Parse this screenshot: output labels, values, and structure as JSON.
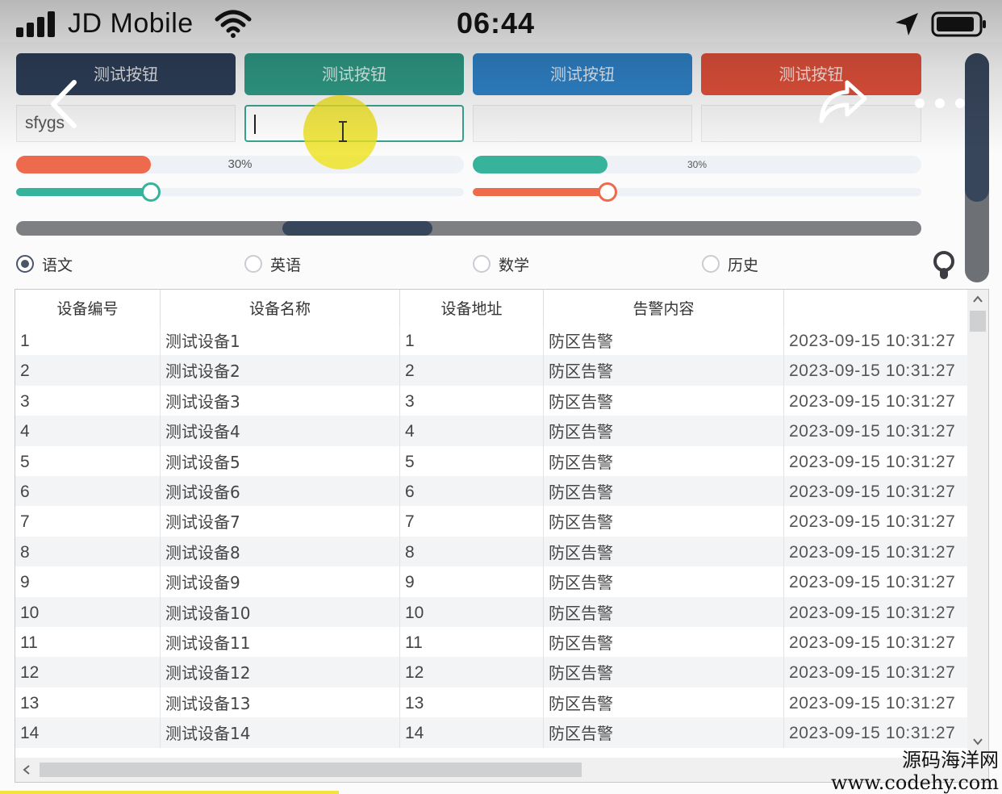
{
  "status_bar": {
    "carrier": "JD Mobile",
    "time": "06:44",
    "icons": [
      "signal-icon",
      "wifi-icon",
      "location-arrow-icon",
      "battery-icon"
    ]
  },
  "nav": {
    "icons": [
      "back-chevron-icon",
      "share-arrow-icon",
      "more-dots-icon"
    ]
  },
  "buttons": [
    {
      "label": "测试按钮",
      "color": "#2d3e57"
    },
    {
      "label": "测试按钮",
      "color": "#2f9a86"
    },
    {
      "label": "测试按钮",
      "color": "#2f82c7"
    },
    {
      "label": "测试按钮",
      "color": "#e0503a"
    }
  ],
  "inputs": [
    {
      "value": "sfygs",
      "focused": false
    },
    {
      "value": "",
      "focused": true
    },
    {
      "value": "",
      "focused": false
    },
    {
      "value": "",
      "focused": false
    }
  ],
  "progress_bars": [
    {
      "value": 30,
      "label": "30%",
      "color": "#ee6a4c"
    },
    {
      "value": 30,
      "label": "30%",
      "color": "#37b29b"
    }
  ],
  "sliders": [
    {
      "value": 30,
      "color": "#37b29b"
    },
    {
      "value": 30,
      "color": "#ee6a4c"
    }
  ],
  "scrollbars": {
    "horizontal_position": 0.36,
    "vertical_position": 0.0
  },
  "radios": [
    {
      "label": "语文",
      "checked": true
    },
    {
      "label": "英语",
      "checked": false
    },
    {
      "label": "数学",
      "checked": false
    },
    {
      "label": "历史",
      "checked": false
    }
  ],
  "table": {
    "columns": [
      "设备编号",
      "设备名称",
      "设备地址",
      "告警内容",
      ""
    ],
    "rows": [
      [
        "1",
        "测试设备1",
        "1",
        "防区告警",
        "2023-09-15 10:31:27"
      ],
      [
        "2",
        "测试设备2",
        "2",
        "防区告警",
        "2023-09-15 10:31:27"
      ],
      [
        "3",
        "测试设备3",
        "3",
        "防区告警",
        "2023-09-15 10:31:27"
      ],
      [
        "4",
        "测试设备4",
        "4",
        "防区告警",
        "2023-09-15 10:31:27"
      ],
      [
        "5",
        "测试设备5",
        "5",
        "防区告警",
        "2023-09-15 10:31:27"
      ],
      [
        "6",
        "测试设备6",
        "6",
        "防区告警",
        "2023-09-15 10:31:27"
      ],
      [
        "7",
        "测试设备7",
        "7",
        "防区告警",
        "2023-09-15 10:31:27"
      ],
      [
        "8",
        "测试设备8",
        "8",
        "防区告警",
        "2023-09-15 10:31:27"
      ],
      [
        "9",
        "测试设备9",
        "9",
        "防区告警",
        "2023-09-15 10:31:27"
      ],
      [
        "10",
        "测试设备10",
        "10",
        "防区告警",
        "2023-09-15 10:31:27"
      ],
      [
        "11",
        "测试设备11",
        "11",
        "防区告警",
        "2023-09-15 10:31:27"
      ],
      [
        "12",
        "测试设备12",
        "12",
        "防区告警",
        "2023-09-15 10:31:27"
      ],
      [
        "13",
        "测试设备13",
        "13",
        "防区告警",
        "2023-09-15 10:31:27"
      ],
      [
        "14",
        "测试设备14",
        "14",
        "防区告警",
        "2023-09-15 10:31:27"
      ]
    ]
  },
  "watermark": {
    "name": "源码海洋网",
    "url": "www.codehy.com"
  }
}
